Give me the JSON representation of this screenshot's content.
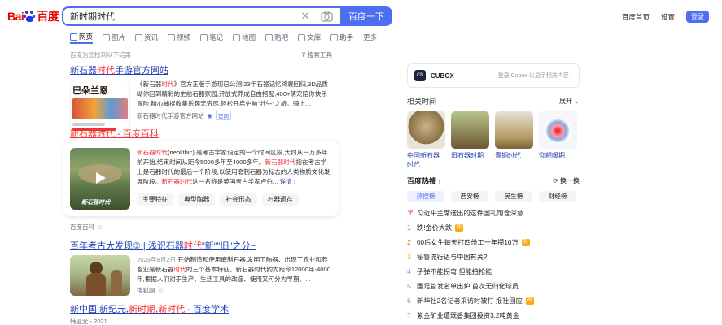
{
  "logo": {
    "part1": "Bai",
    "part2": "百度"
  },
  "search": {
    "query": "新时期时代",
    "button": "百度一下"
  },
  "top_links": {
    "home": "百度首页",
    "settings": "设置",
    "login": "登录"
  },
  "tabs": [
    "网页",
    "图片",
    "资讯",
    "视频",
    "笔记",
    "地图",
    "贴吧",
    "文库",
    "助手",
    "更多"
  ],
  "found_text": "百度为您找到以下结果",
  "tools_text": "搜索工具",
  "results": {
    "r1": {
      "title_pre": "新石器",
      "title_hl": "时代",
      "title_post": "手游官方网站",
      "thumb_text": "巴朵兰恩",
      "desc_pre": "《新石器",
      "desc_hl": "时代",
      "desc_post": "》官方正版手游现已公测!23年石器记忆终裹回归,3D品质呦你回到精彩的史前石器家园,开放式养成自由搭配,400+萌宠陪你快乐冒险,精心捕捉收集乐趣无穷尽,轻松开启史前\"壮牛\"之旅。骑上...",
      "source": "新石器时代手游官方网站",
      "badge": "官网"
    },
    "r2": {
      "title_pre": "新石器",
      "title_hl": "时代",
      "title_post": " - 百度百科",
      "thumb_text": "新石器时代",
      "desc_hl1": "新石器时代",
      "desc_1": "(neolithic),是考古学家设定的一个时间区段,大约从一万多年前开始,结束时间从距今5000多年至4000多年。",
      "desc_hl2": "新石器时代",
      "desc_2": "指在考古学上是石器时代的最后一个阶段,以使用磨制石器为标志的人类物质文化发展阶段。",
      "desc_hl3": "新石器时代",
      "desc_3": "这一名称是英国考古学家卢伯...",
      "more": "详情",
      "tags": [
        "主要特征",
        "典型陶器",
        "社会形态",
        "石器遗存"
      ],
      "source": "百度百科"
    },
    "r3": {
      "title_pre": "百年考古大发现③ | 浅识石器",
      "title_hl": "时代",
      "title_mid": "\"新\"\"旧\"之分~",
      "date": "2023年8月2日",
      "desc_1": " 开始制造和使用磨制石器,发明了陶器、出现了农业和养畜业是新石器",
      "desc_hl": "时代",
      "desc_2": "的三个基本特征。新石器时代约为距今12000年-4000年,根据人们对于生产、生活工具的改造、使用又可分为早期、...",
      "source": "搜狐网"
    },
    "r4": {
      "title_pre": "新中国:新纪元,",
      "title_hl1": "新时期",
      "title_mid": ",",
      "title_hl2": "新时代",
      "title_post": " - 百度学术",
      "source": "韩亚光 - 2021"
    }
  },
  "right": {
    "cubox_name": "CUBOX",
    "cubox_login": "登录 Cubox 以显示相关内容",
    "related_title": "相关时间",
    "expand": "展开",
    "related": [
      "中国新石器时代",
      "旧石器时期",
      "青铜时代",
      "仰韶暖期"
    ],
    "hot_title": "百度热搜",
    "refresh": "换一换",
    "hot_tabs": [
      "热搜榜",
      "西安榜",
      "民生榜",
      "财经榜"
    ],
    "hot_items": [
      {
        "rank": "",
        "text": "习近平主席送出的这件国礼饱含深意",
        "tag": ""
      },
      {
        "rank": "1",
        "text": "跌!金价大跌",
        "tag": "热"
      },
      {
        "rank": "2",
        "text": "00后女生每天打四份工一年攒10万",
        "tag": "热"
      },
      {
        "rank": "3",
        "text": "秘鲁流行语与中国有关?",
        "tag": ""
      },
      {
        "rank": "4",
        "text": "子弹不能拐弯 但能拍抢能",
        "tag": ""
      },
      {
        "rank": "5",
        "text": "国足首发名单出炉 首次无归化球员",
        "tag": ""
      },
      {
        "rank": "6",
        "text": "新华社2名记者采访时被打 报社回应",
        "tag": "热"
      },
      {
        "rank": "7",
        "text": "紫金矿业遭既香集团投资3.2吨黄金",
        "tag": ""
      }
    ]
  }
}
